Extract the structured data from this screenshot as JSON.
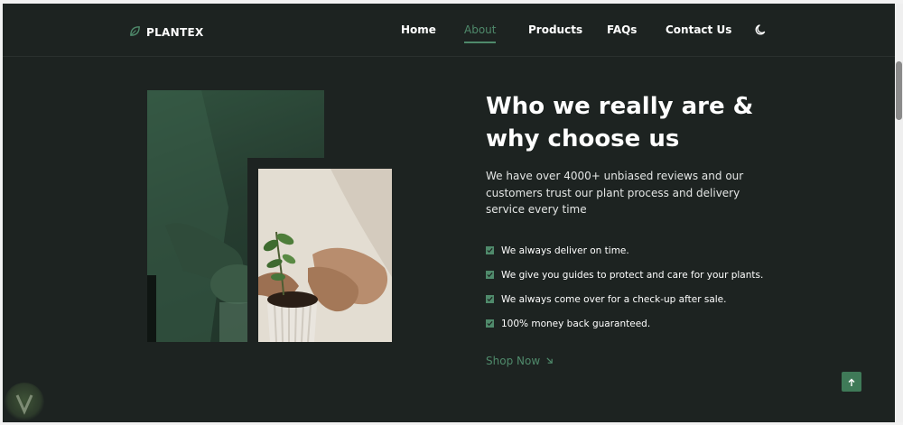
{
  "brand": {
    "name": "PLANTEX",
    "logo_icon": "leaf-icon"
  },
  "nav": {
    "items": [
      {
        "label": "Home",
        "active": false
      },
      {
        "label": "About",
        "active": true
      },
      {
        "label": "Products",
        "active": false
      },
      {
        "label": "FAQs",
        "active": false
      },
      {
        "label": "Contact Us",
        "active": false
      }
    ],
    "theme_icon": "moon-icon"
  },
  "about": {
    "title_line1": "Who we really are &",
    "title_line2": "why choose us",
    "description": "We have over 4000+ unbiased reviews and our customers trust our plant process and delivery service every time",
    "features": [
      "We always deliver on time.",
      "We give you guides to protect and care for your plants.",
      "We always come over for a check-up after sale.",
      "100% money back guaranteed."
    ],
    "cta_label": "Shop Now",
    "cta_icon": "arrow-down-right-icon"
  },
  "back_to_top_icon": "arrow-up-icon",
  "colors": {
    "background": "#1d2321",
    "accent": "#4f8a6b",
    "text": "#ffffff"
  }
}
